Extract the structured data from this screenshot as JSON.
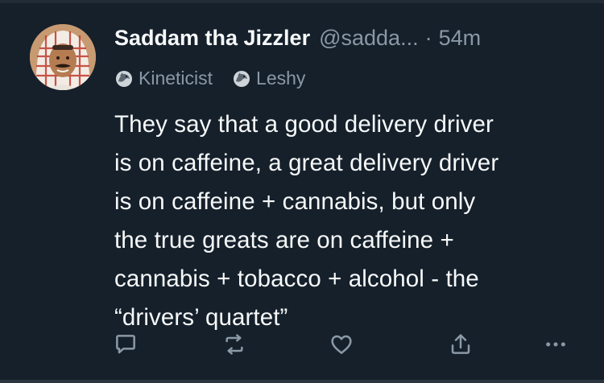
{
  "tweet": {
    "display_name": "Saddam tha Jizzler",
    "handle": "@sadda...",
    "separator": "·",
    "timestamp": "54m",
    "badges": [
      {
        "label": "Kineticist",
        "icon": "dragon-emblem-icon"
      },
      {
        "label": "Leshy",
        "icon": "dragon-emblem-icon"
      }
    ],
    "text_lines": [
      "They say that a good delivery driver",
      "is on caffeine, a great delivery driver",
      "is on caffeine + cannabis, but only",
      "the true greats are on caffeine +",
      "cannabis + tobacco + alcohol - the",
      "“drivers’ quartet”"
    ],
    "actions": [
      {
        "name": "reply",
        "icon": "reply-icon"
      },
      {
        "name": "retweet",
        "icon": "retweet-icon"
      },
      {
        "name": "like",
        "icon": "heart-icon"
      },
      {
        "name": "share",
        "icon": "share-icon"
      },
      {
        "name": "more",
        "icon": "more-icon"
      }
    ]
  },
  "colors": {
    "background": "#15202b",
    "primary_text": "#f7f9f9",
    "secondary_text": "#8b98a5"
  }
}
